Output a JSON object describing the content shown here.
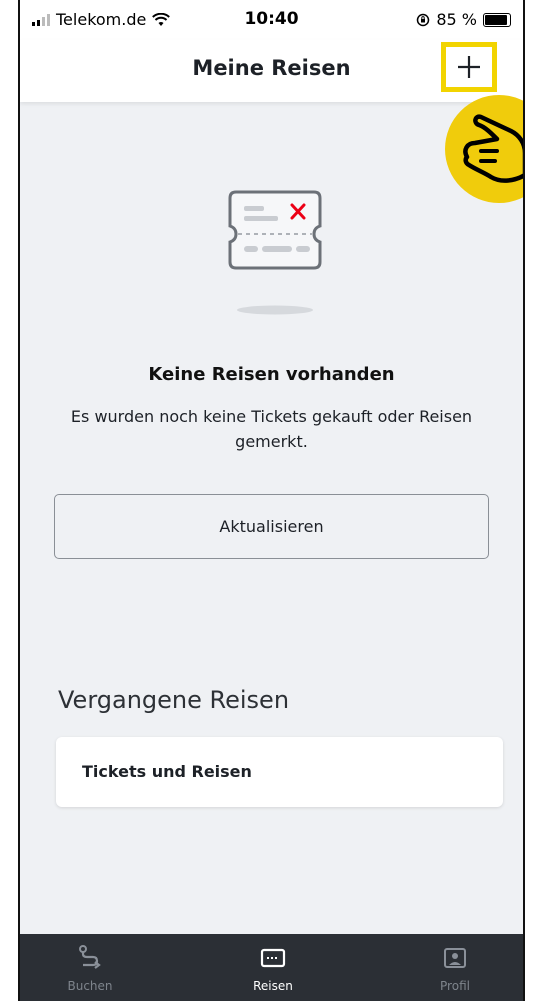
{
  "status_bar": {
    "carrier": "Telekom.de",
    "time": "10:40",
    "battery": "85 %"
  },
  "header": {
    "title": "Meine Reisen"
  },
  "empty_state": {
    "title": "Keine Reisen vorhanden",
    "text": "Es wurden noch keine Tickets gekauft oder Reisen gemerkt.",
    "refresh_label": "Aktualisieren"
  },
  "past_trips": {
    "heading": "Vergangene Reisen",
    "card_label": "Tickets und Reisen"
  },
  "tabbar": {
    "items": [
      {
        "label": "Buchen",
        "icon": "route-icon"
      },
      {
        "label": "Reisen",
        "icon": "ticket-icon"
      },
      {
        "label": "Profil",
        "icon": "profile-icon"
      }
    ]
  },
  "colors": {
    "highlight": "#f2d400",
    "accent_red": "#ec0016",
    "background": "#eff1f4",
    "tabbar": "#2b2f35"
  }
}
